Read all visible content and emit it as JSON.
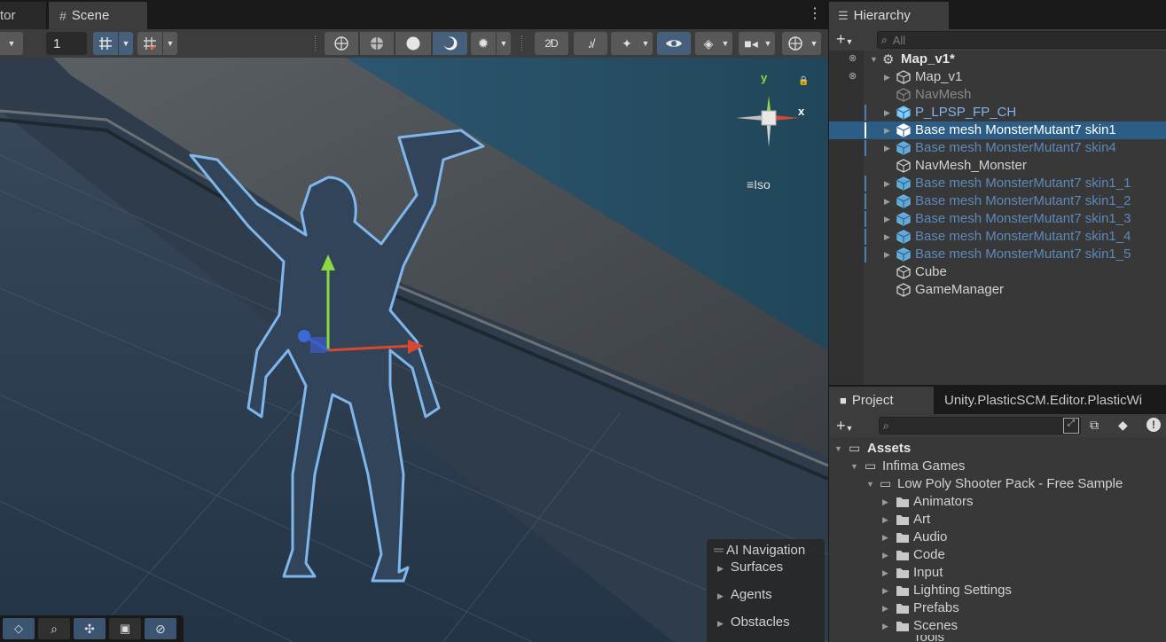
{
  "scene_tabs": {
    "left_partial": "tor",
    "scene": "Scene"
  },
  "toolbar": {
    "grid_size": "1"
  },
  "gizmo": {
    "y": "y",
    "x": "x",
    "projection": "Iso"
  },
  "ai_nav": {
    "title": "AI Navigation",
    "items": [
      "Surfaces",
      "Agents",
      "Obstacles"
    ]
  },
  "hierarchy": {
    "tab": "Hierarchy",
    "search_placeholder": "All",
    "root": "Map_v1*",
    "items": [
      {
        "label": "Map_v1",
        "style": "normal",
        "expand": true
      },
      {
        "label": "NavMesh",
        "style": "gray",
        "expand": false
      },
      {
        "label": "P_LPSP_FP_CH",
        "style": "prefab",
        "expand": true
      },
      {
        "label": "Base mesh MonsterMutant7 skin1",
        "style": "selected",
        "expand": true
      },
      {
        "label": "Base mesh MonsterMutant7 skin4",
        "style": "prefab-faded",
        "expand": true
      },
      {
        "label": "NavMesh_Monster",
        "style": "normal",
        "expand": false
      },
      {
        "label": "Base mesh MonsterMutant7 skin1_1",
        "style": "prefab-faded",
        "expand": true
      },
      {
        "label": "Base mesh MonsterMutant7 skin1_2",
        "style": "prefab-faded",
        "expand": true
      },
      {
        "label": "Base mesh MonsterMutant7 skin1_3",
        "style": "prefab-faded",
        "expand": true
      },
      {
        "label": "Base mesh MonsterMutant7 skin1_4",
        "style": "prefab-faded",
        "expand": true
      },
      {
        "label": "Base mesh MonsterMutant7 skin1_5",
        "style": "prefab-faded",
        "expand": true
      },
      {
        "label": "Cube",
        "style": "normal",
        "expand": false
      },
      {
        "label": "GameManager",
        "style": "normal",
        "expand": false
      }
    ]
  },
  "project": {
    "tab": "Project",
    "tab2": "Unity.PlasticSCM.Editor.PlasticWi",
    "assets": "Assets",
    "infima": "Infima Games",
    "pack": "Low Poly Shooter Pack - Free Sample",
    "folders": [
      "Animators",
      "Art",
      "Audio",
      "Code",
      "Input",
      "Lighting Settings",
      "Prefabs",
      "Scenes"
    ],
    "cut": "Tools"
  },
  "colors": {
    "selection": "#2c5d87",
    "prefab": "#7fb4f0",
    "accent_button": "#46607c"
  }
}
